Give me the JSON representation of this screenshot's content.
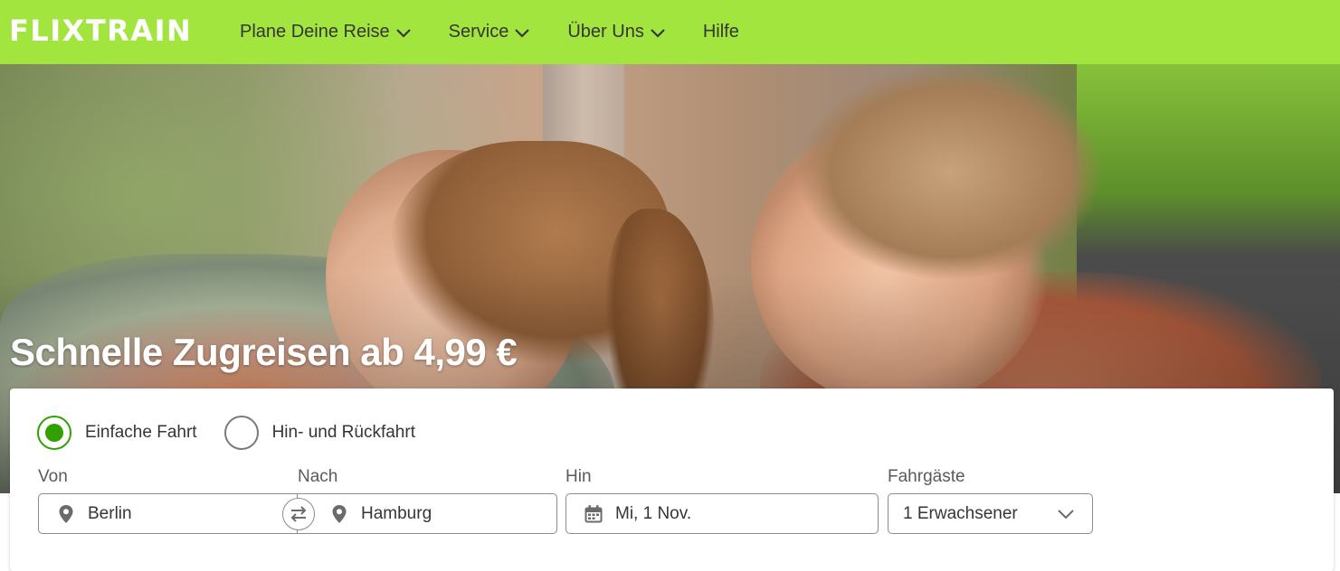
{
  "header": {
    "logo": "FLIXTRAIN",
    "nav": [
      {
        "label": "Plane Deine Reise",
        "has_dropdown": true
      },
      {
        "label": "Service",
        "has_dropdown": true
      },
      {
        "label": "Über Uns",
        "has_dropdown": true
      },
      {
        "label": "Hilfe",
        "has_dropdown": false
      }
    ]
  },
  "hero": {
    "headline": "Schnelle Zugreisen ab 4,99 €"
  },
  "search": {
    "trip_type": {
      "options": [
        {
          "label": "Einfache Fahrt",
          "checked": true
        },
        {
          "label": "Hin- und Rückfahrt",
          "checked": false
        }
      ]
    },
    "from": {
      "label": "Von",
      "value": "Berlin"
    },
    "to": {
      "label": "Nach",
      "value": "Hamburg"
    },
    "date": {
      "label": "Hin",
      "value": "Mi, 1 Nov."
    },
    "passengers": {
      "label": "Fahrgäste",
      "value": "1 Erwachsener"
    }
  },
  "colors": {
    "brand_green": "#a3e53f",
    "radio_green": "#31a100",
    "text": "#353535"
  },
  "icons": [
    "chevron-down-icon",
    "map-pin-icon",
    "swap-icon",
    "calendar-icon"
  ]
}
